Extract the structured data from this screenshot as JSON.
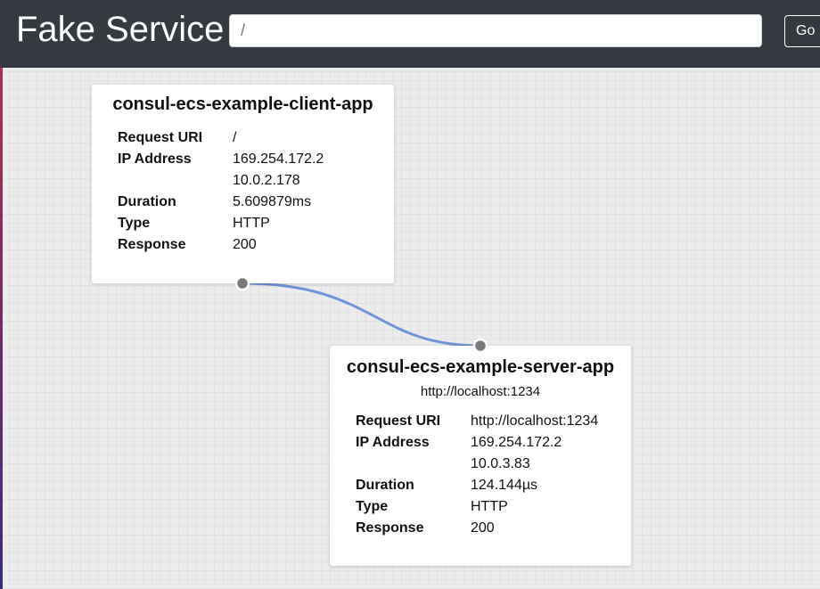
{
  "header": {
    "brand": "Fake Service",
    "search_value": "/",
    "go_label": "Go"
  },
  "colors": {
    "navbar": "#343a40",
    "connector": "#6f94d8",
    "port": "#7a7a7a"
  },
  "client_app": {
    "title": "consul-ecs-example-client-app",
    "labels": {
      "request_uri": "Request URI",
      "ip_address": "IP Address",
      "duration": "Duration",
      "type": "Type",
      "response": "Response"
    },
    "request_uri": "/",
    "ip_addresses": [
      "169.254.172.2",
      "10.0.2.178"
    ],
    "duration": "5.609879ms",
    "type": "HTTP",
    "response": "200"
  },
  "server_app": {
    "title": "consul-ecs-example-server-app",
    "subtitle": "http://localhost:1234",
    "labels": {
      "request_uri": "Request URI",
      "ip_address": "IP Address",
      "duration": "Duration",
      "type": "Type",
      "response": "Response"
    },
    "request_uri": "http://localhost:1234",
    "ip_addresses": [
      "169.254.172.2",
      "10.0.3.83"
    ],
    "duration": "124.144µs",
    "type": "HTTP",
    "response": "200"
  }
}
